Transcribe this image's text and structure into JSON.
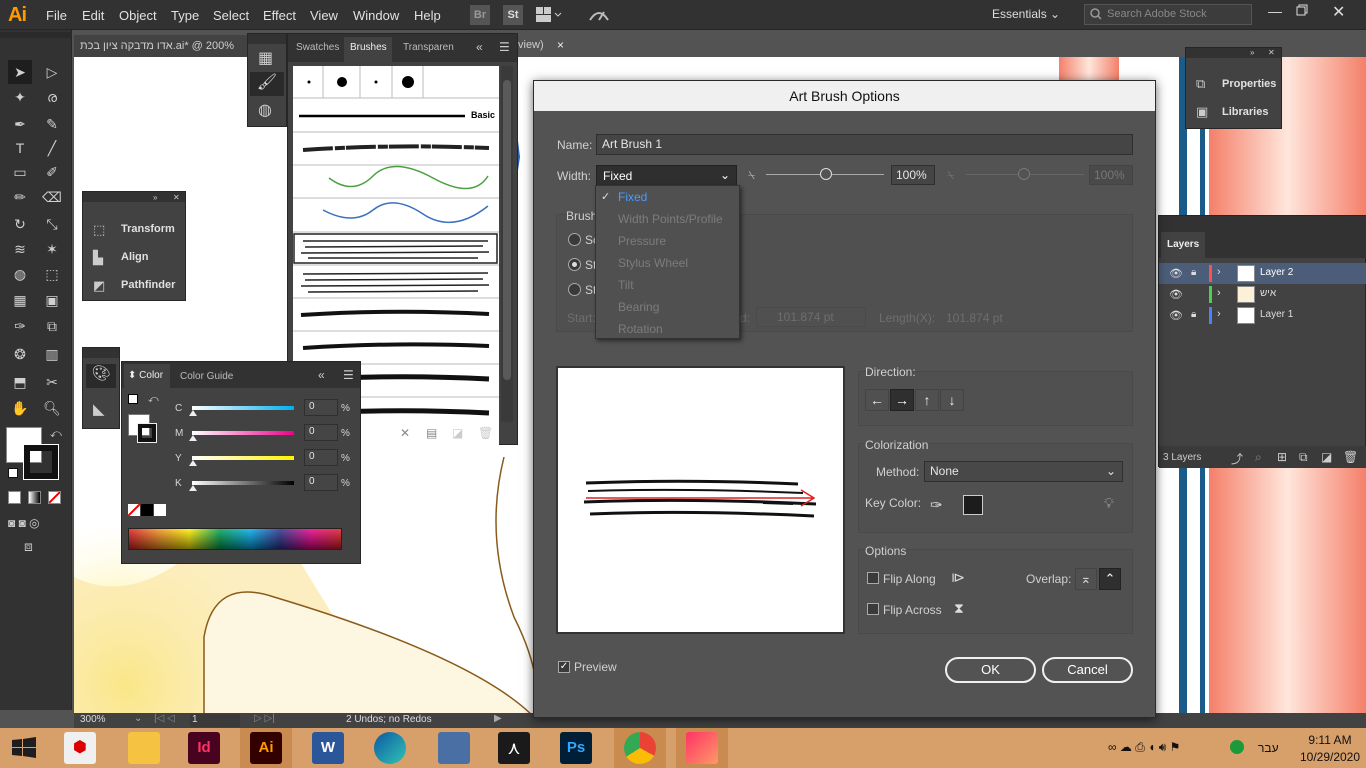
{
  "app": {
    "logo": "Ai"
  },
  "menu": [
    "File",
    "Edit",
    "Object",
    "Type",
    "Select",
    "Effect",
    "View",
    "Window",
    "Help"
  ],
  "topbar": {
    "bridge": "Br",
    "stock": "St",
    "workspace": "Essentials",
    "search_placeholder": "Search Adobe Stock"
  },
  "document": {
    "tab_title": "אדו מדבקה ציון בכת.ai* @ 200%",
    "tab_suffix": "view)",
    "close": "×"
  },
  "brushes_panel": {
    "tabs": [
      "Swatches",
      "Brushes",
      "Transparen"
    ],
    "basic_label": "Basic"
  },
  "transform_panel": {
    "items": [
      "Transform",
      "Align",
      "Pathfinder"
    ]
  },
  "color_panel": {
    "tabs": [
      "Color",
      "Color Guide"
    ],
    "sliders": [
      {
        "label": "C",
        "value": "0",
        "unit": "%"
      },
      {
        "label": "M",
        "value": "0",
        "unit": "%"
      },
      {
        "label": "Y",
        "value": "0",
        "unit": "%"
      },
      {
        "label": "K",
        "value": "0",
        "unit": "%"
      }
    ]
  },
  "right_dock": {
    "items": [
      "Properties",
      "Libraries"
    ]
  },
  "layers_panel": {
    "title": "Layers",
    "layers": [
      {
        "name": "Layer 2",
        "color": "#ff4f4f"
      },
      {
        "name": "איש",
        "color": "#4fcf4f"
      },
      {
        "name": "Layer 1",
        "color": "#4f7fff"
      }
    ],
    "count": "3 Layers"
  },
  "dialog": {
    "title": "Art Brush Options",
    "name_label": "Name:",
    "name_value": "Art Brush 1",
    "width_label": "Width:",
    "width_value": "Fixed",
    "width_percent": "100%",
    "width_percent2": "100%",
    "brush_scale_label": "Brush",
    "scale_radio": [
      "Sc",
      "St",
      "St"
    ],
    "start_label": "Start:",
    "end_label": "d:",
    "end_value": "101.874 pt",
    "length_label": "Length(X):",
    "length_value": "101.874 pt",
    "direction_label": "Direction:",
    "direction_arrows": [
      "←",
      "→",
      "↑",
      "↓"
    ],
    "colorization_label": "Colorization",
    "method_label": "Method:",
    "method_value": "None",
    "key_color_label": "Key Color:",
    "options_label": "Options",
    "flip_along": "Flip Along",
    "flip_across": "Flip Across",
    "overlap_label": "Overlap:",
    "preview_label": "Preview",
    "ok": "OK",
    "cancel": "Cancel"
  },
  "width_dropdown": {
    "selected": "Fixed",
    "items": [
      "Fixed",
      "Width Points/Profile",
      "Pressure",
      "Stylus Wheel",
      "Tilt",
      "Bearing",
      "Rotation"
    ]
  },
  "statusbar": {
    "zoom": "300%",
    "artboard": "1",
    "status": "2 Undos; no Redos"
  },
  "taskbar": {
    "lang": "עבר",
    "time": "9:11 AM",
    "date": "10/29/2020"
  },
  "colors": {
    "accent_blue": "#4a9bff",
    "key_color": "#1c1c1c"
  }
}
